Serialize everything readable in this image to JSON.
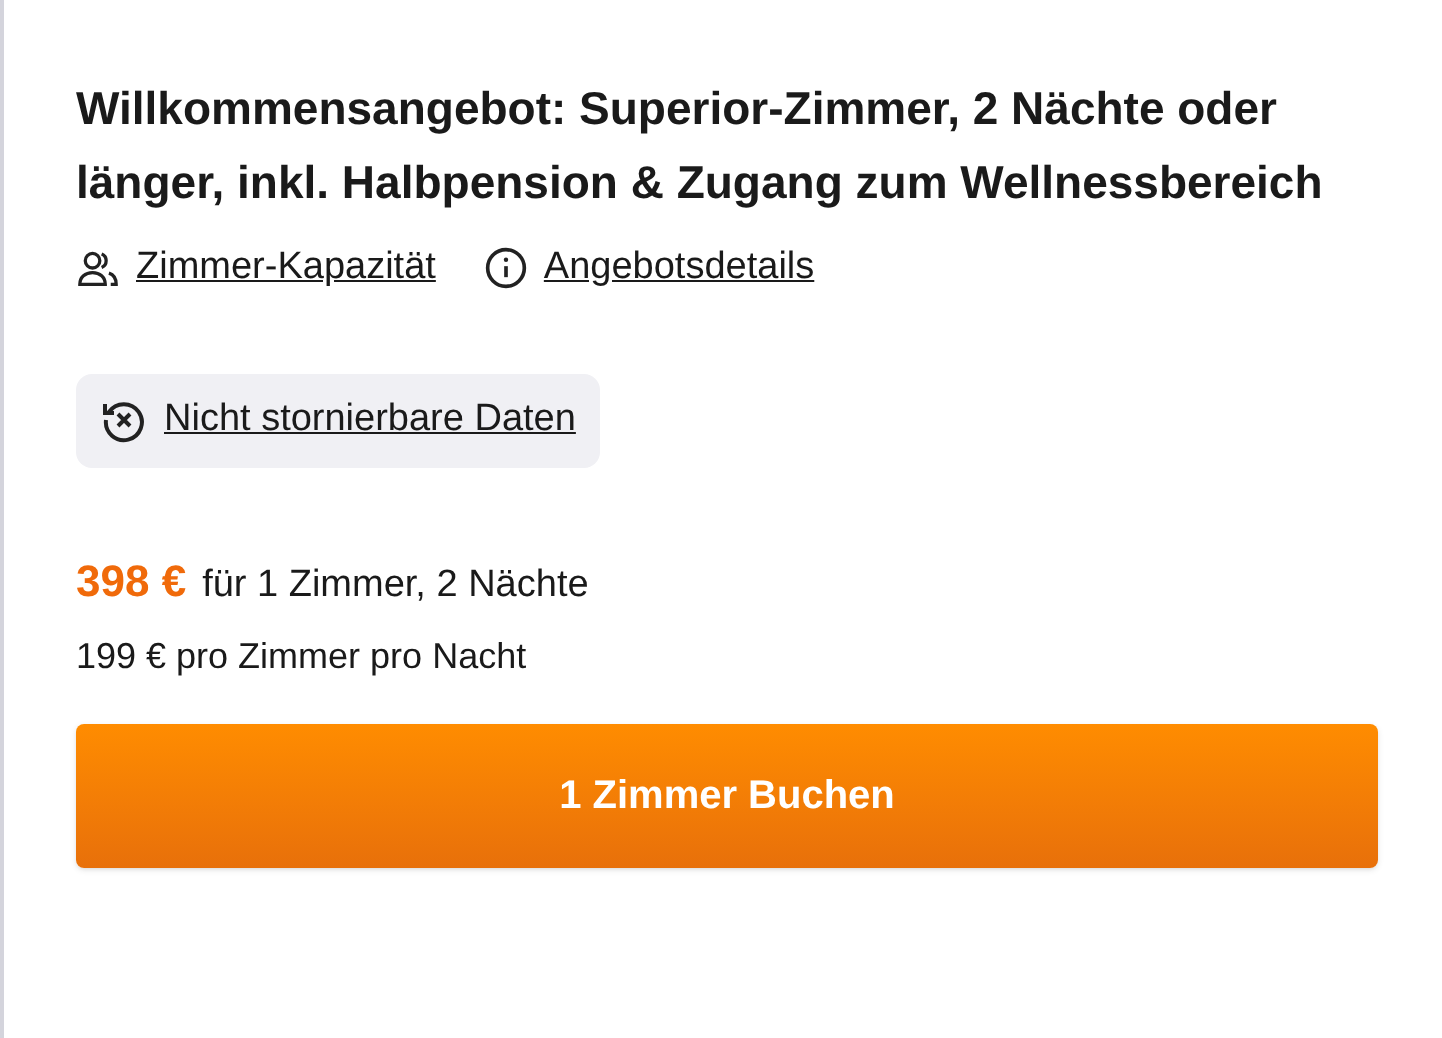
{
  "offer": {
    "title": "Willkommensangebot: Superior-Zimmer, 2 Nächte oder länger, inkl. Halbpension & Zugang zum Wellnessbereich",
    "links": [
      {
        "kind": "people",
        "label": "Zimmer-Kapazität"
      },
      {
        "kind": "info",
        "label": "Angebotsdetails"
      }
    ],
    "cancellation": {
      "label": "Nicht stornierbare Daten"
    },
    "price": {
      "total": "398 €",
      "total_note": "für 1 Zimmer, 2 Nächte",
      "per_night": "199 € pro Zimmer pro Nacht"
    },
    "book_button": "1 Zimmer Buchen"
  }
}
